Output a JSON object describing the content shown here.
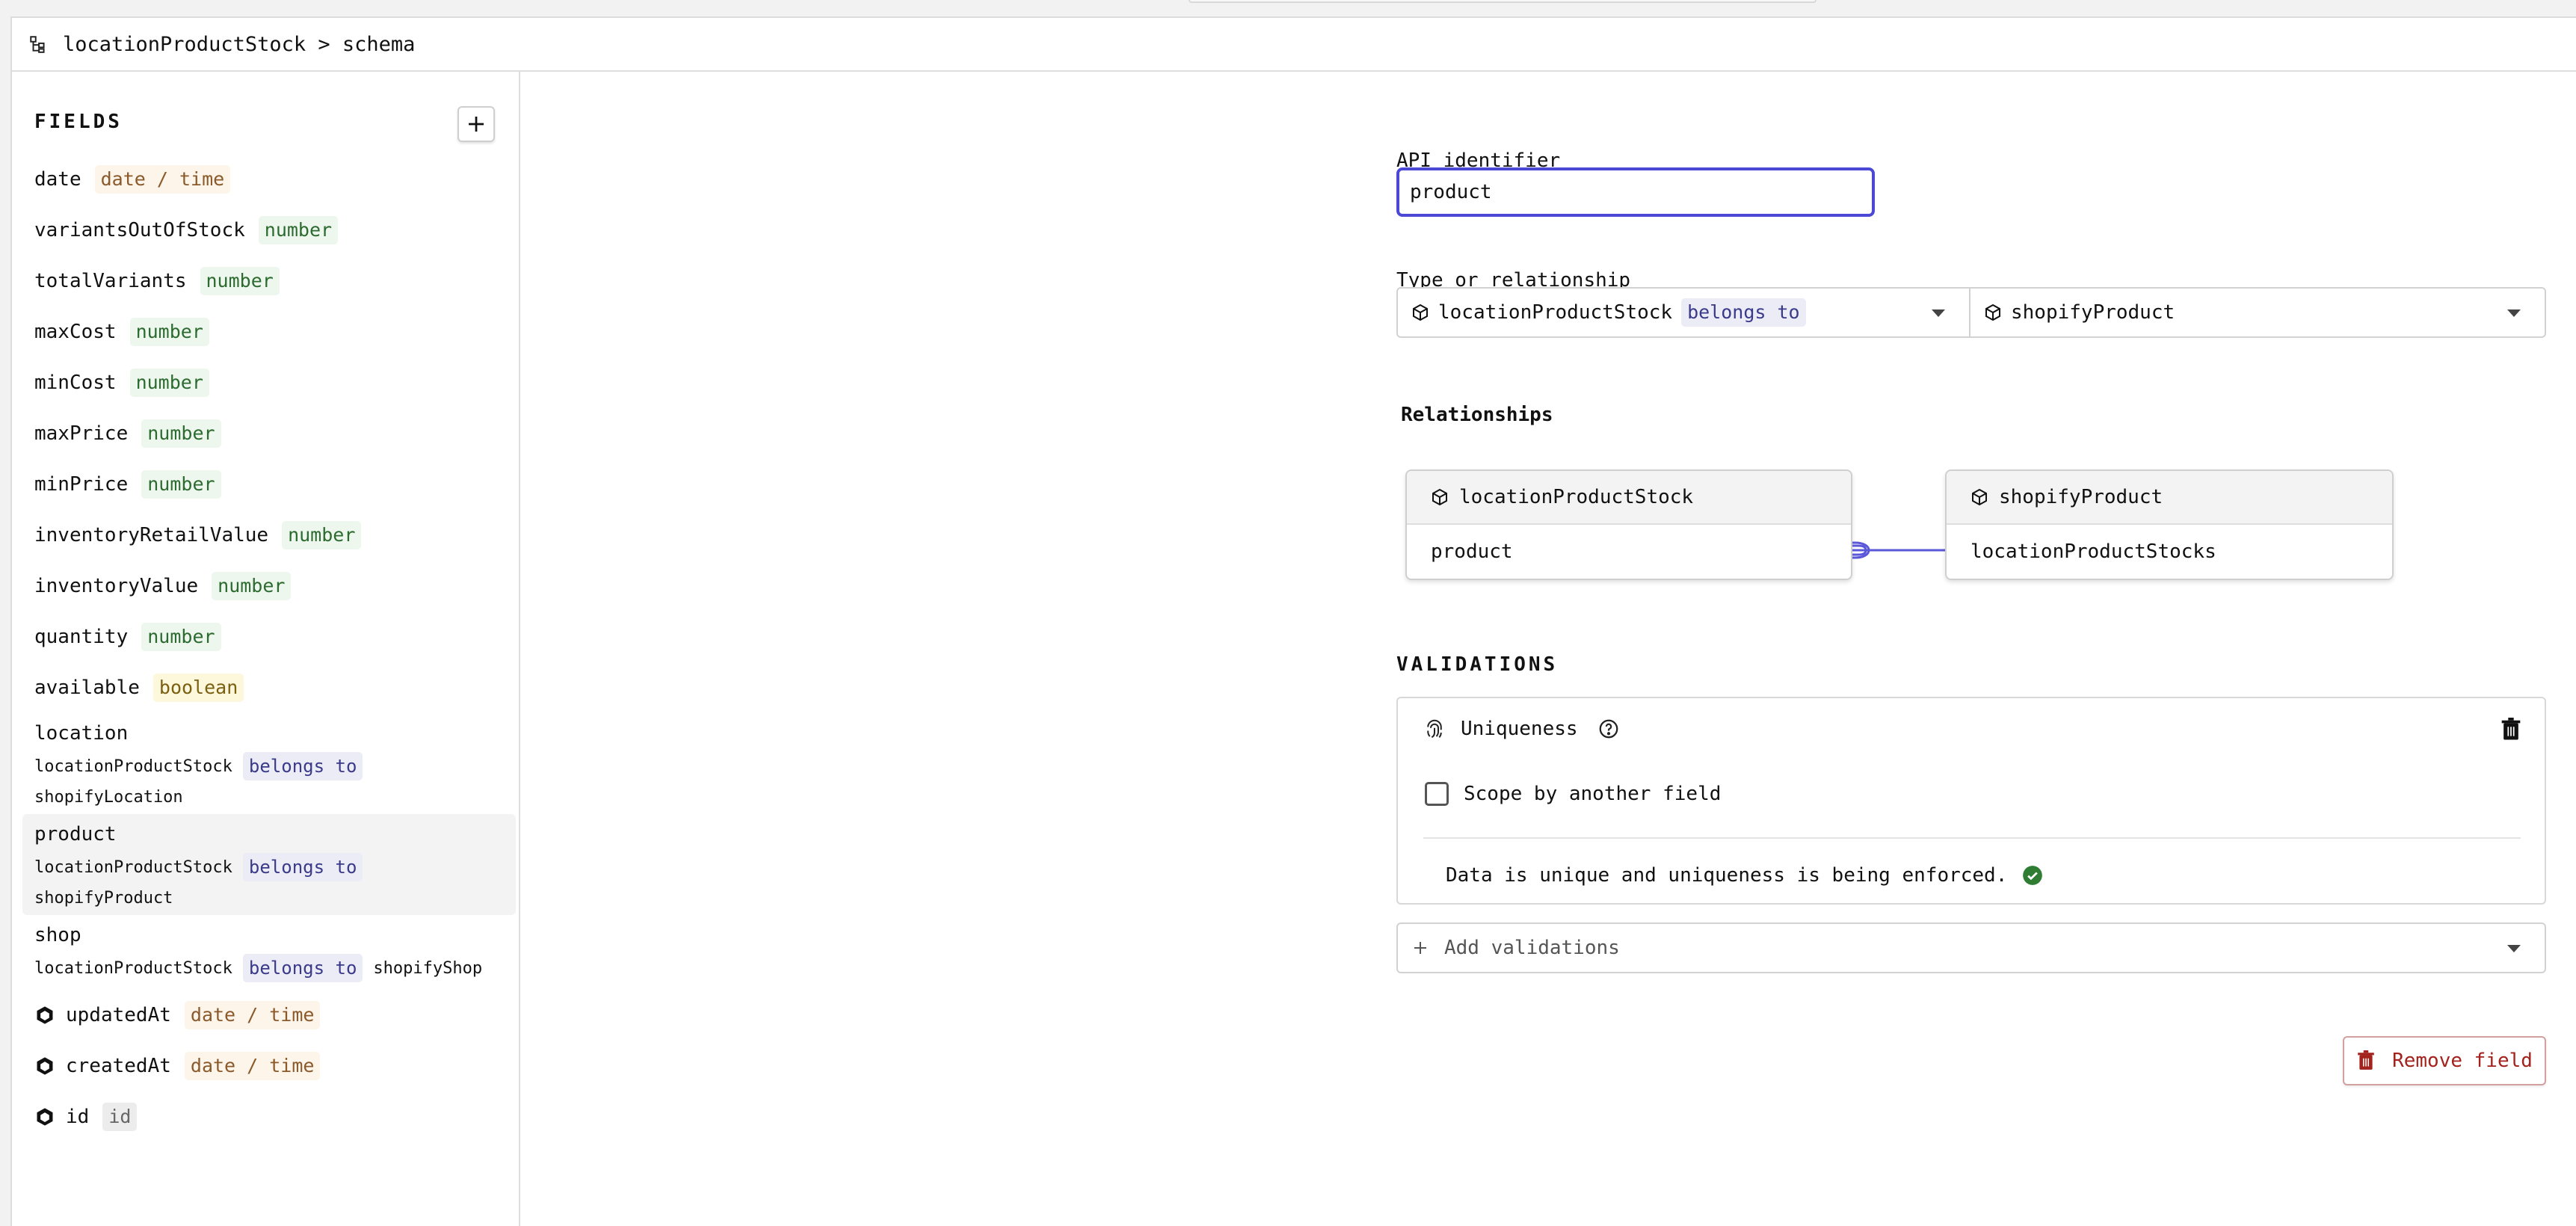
{
  "breadcrumb": {
    "text": "locationProductStock > schema",
    "icon": "schema-tree-icon"
  },
  "sidebar": {
    "header": "FIELDS",
    "add_icon": "plus-icon",
    "fields": [
      {
        "name": "date",
        "type": "date / time"
      },
      {
        "name": "variantsOutOfStock",
        "type": "number"
      },
      {
        "name": "totalVariants",
        "type": "number"
      },
      {
        "name": "maxCost",
        "type": "number"
      },
      {
        "name": "minCost",
        "type": "number"
      },
      {
        "name": "maxPrice",
        "type": "number"
      },
      {
        "name": "minPrice",
        "type": "number"
      },
      {
        "name": "inventoryRetailValue",
        "type": "number"
      },
      {
        "name": "inventoryValue",
        "type": "number"
      },
      {
        "name": "quantity",
        "type": "number"
      },
      {
        "name": "available",
        "type": "boolean"
      }
    ],
    "relationships": [
      {
        "name": "location",
        "model": "locationProductStock",
        "relation": "belongs to",
        "target": "shopifyLocation"
      },
      {
        "name": "product",
        "model": "locationProductStock",
        "relation": "belongs to",
        "target": "shopifyProduct"
      },
      {
        "name": "shop",
        "model": "locationProductStock",
        "relation": "belongs to",
        "target": "shopifyShop"
      }
    ],
    "system_fields": [
      {
        "name": "updatedAt",
        "type": "date / time"
      },
      {
        "name": "createdAt",
        "type": "date / time"
      },
      {
        "name": "id",
        "type": "id"
      }
    ]
  },
  "form": {
    "api_identifier_label": "API identifier",
    "api_identifier_value": "product",
    "type_label": "Type or relationship",
    "type_model": "locationProductStock",
    "type_relation": "belongs to",
    "related_model": "shopifyProduct"
  },
  "relationships_section": {
    "heading": "Relationships",
    "left_model": "locationProductStock",
    "left_field": "product",
    "right_model": "shopifyProduct",
    "right_field": "locationProductStocks"
  },
  "validations": {
    "heading": "VALIDATIONS",
    "uniqueness_label": "Uniqueness",
    "scope_label": "Scope by another field",
    "status_text": "Data is unique and uniqueness is being enforced.",
    "add_placeholder": "Add validations"
  },
  "remove_button": "Remove field",
  "colors": {
    "accent": "#4b48d6",
    "danger": "#a3221c",
    "success": "#2e7d32"
  }
}
